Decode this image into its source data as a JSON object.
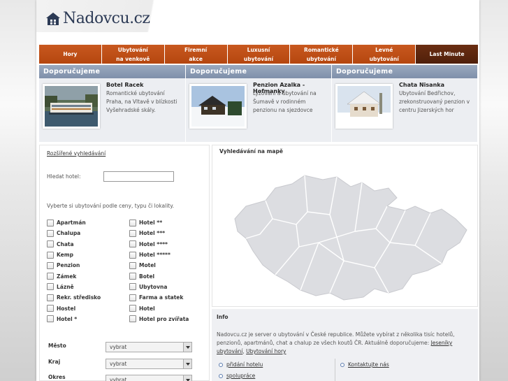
{
  "header": {
    "logo_text": "Nadovcu.cz"
  },
  "nav": [
    {
      "line1": "Hory",
      "line2": ""
    },
    {
      "line1": "Ubytování",
      "line2": "na venkově"
    },
    {
      "line1": "Firemní",
      "line2": "akce"
    },
    {
      "line1": "Luxusní",
      "line2": "ubytování"
    },
    {
      "line1": "Romantické",
      "line2": "ubytování"
    },
    {
      "line1": "Levné",
      "line2": "ubytování"
    },
    {
      "line1": "Last Minute",
      "line2": ""
    }
  ],
  "recommendations": [
    {
      "heading": "Doporučujeme",
      "title": "Botel Racek",
      "desc": "Romantické ubytování Praha, na Vltavě v blízkosti Vyšehradské skály."
    },
    {
      "heading": "Doporučujeme",
      "title": "Penzion Azalka - Hofmanky",
      "desc": "Lyžování a ubytování na Šumavě v rodinném penzionu na sjezdovce"
    },
    {
      "heading": "Doporučujeme",
      "title": "Chata Nisanka",
      "desc": "Ubytování Bedřichov, zrekonstruovaný penzion v centru Jizerských hor"
    }
  ],
  "search": {
    "advanced_link": "Rozšířené vyhledávání",
    "hotel_label": "Hledat hotel:",
    "hotel_value": "",
    "select_hint": "Vyberte si ubytování podle ceny, typu či lokality.",
    "types_col1": [
      "Apartmán",
      "Chalupa",
      "Chata",
      "Kemp",
      "Penzion",
      "Zámek",
      "Lázně",
      "Rekr. středisko",
      "Hostel",
      "Hotel *"
    ],
    "types_col2": [
      "Hotel **",
      "Hotel ***",
      "Hotel ****",
      "Hotel *****",
      "Motel",
      "Botel",
      "Ubytovna",
      "Farma a statek",
      "Hotel",
      "Hotel pro zvířata"
    ],
    "city_label": "Město",
    "city_value": "vybrat",
    "region_label": "Kraj",
    "region_value": "vybrat",
    "district_label": "Okres",
    "district_value": "vybrat"
  },
  "map": {
    "title": "Vyhledávání na mapě",
    "fill_color": "#dcdde1",
    "border_color": "#ffffff"
  },
  "info": {
    "title": "Info",
    "text": "Nadovcu.cz je server o ubytování v České republice. Můžete vybírat z několika tisíc hotelů, penzionů, apartmánů, chat a chalup ze všech koutů ČR. Aktuálně doporučujeme:",
    "link1": "Jeseníky ubytování",
    "sep": ", ",
    "link2": "Ubytování hory",
    "left_links": [
      "přidání hotelu",
      "spolupráce"
    ],
    "right_links": [
      "Kontaktujte nás"
    ]
  },
  "colors": {
    "nav": "#b94b14",
    "nav_last": "#5a2410",
    "rec_head": "#8697b0"
  }
}
